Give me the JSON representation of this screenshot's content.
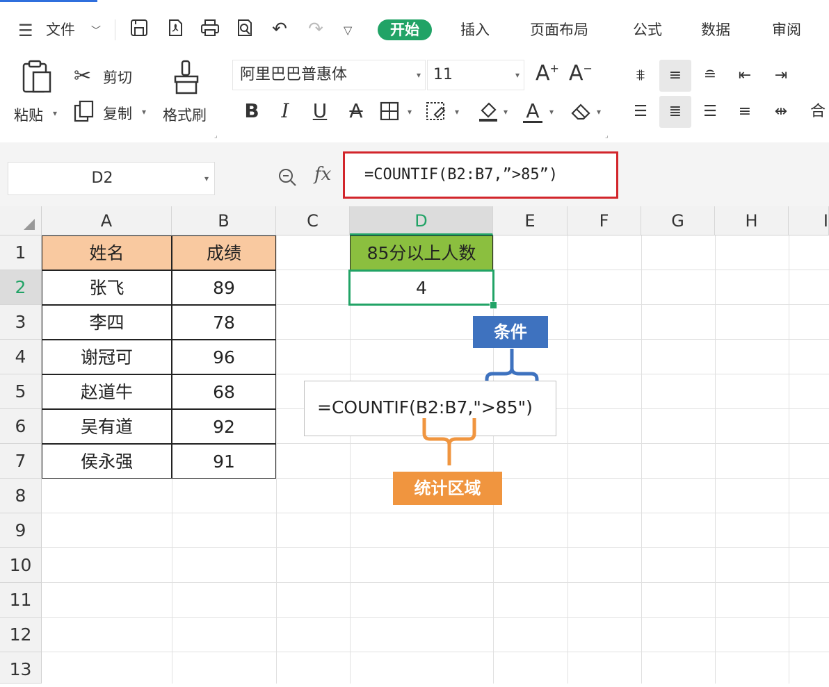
{
  "menu": {
    "hamburger_label": "文件",
    "tabs": [
      "开始",
      "插入",
      "页面布局",
      "公式",
      "数据",
      "审阅"
    ],
    "active_tab": "开始"
  },
  "clipboard": {
    "paste_label": "粘贴",
    "cut_label": "剪切",
    "copy_label": "复制",
    "format_painter_label": "格式刷"
  },
  "font": {
    "family": "阿里巴巴普惠体",
    "size": "11"
  },
  "formula_bar": {
    "name_box": "D2",
    "fx_label": "fx",
    "formula": "=COUNTIF(B2:B7,”>85”)"
  },
  "columns": [
    "A",
    "B",
    "C",
    "D",
    "E",
    "F",
    "G",
    "H",
    "I"
  ],
  "rows": [
    "1",
    "2",
    "3",
    "4",
    "5",
    "6",
    "7",
    "8",
    "9",
    "10",
    "11",
    "12",
    "13"
  ],
  "table": {
    "header_name": "姓名",
    "header_score": "成绩",
    "records": [
      {
        "name": "张飞",
        "score": "89"
      },
      {
        "name": "李四",
        "score": "78"
      },
      {
        "name": "谢冠可",
        "score": "96"
      },
      {
        "name": "赵道牛",
        "score": "68"
      },
      {
        "name": "吴有道",
        "score": "92"
      },
      {
        "name": "侯永强",
        "score": "91"
      }
    ]
  },
  "result": {
    "header": "85分以上人数",
    "value": "4"
  },
  "annotation": {
    "formula_text": "=COUNTIF(B2:B7,\">85\")",
    "condition_label": "条件",
    "range_label": "统计区域"
  },
  "colors": {
    "accent_green": "#21a366",
    "formula_highlight": "#d2252b",
    "table_header": "#f9c9a0",
    "result_header": "#8bbf3f",
    "condition_blue": "#3e72bf",
    "range_orange": "#f0953f"
  }
}
